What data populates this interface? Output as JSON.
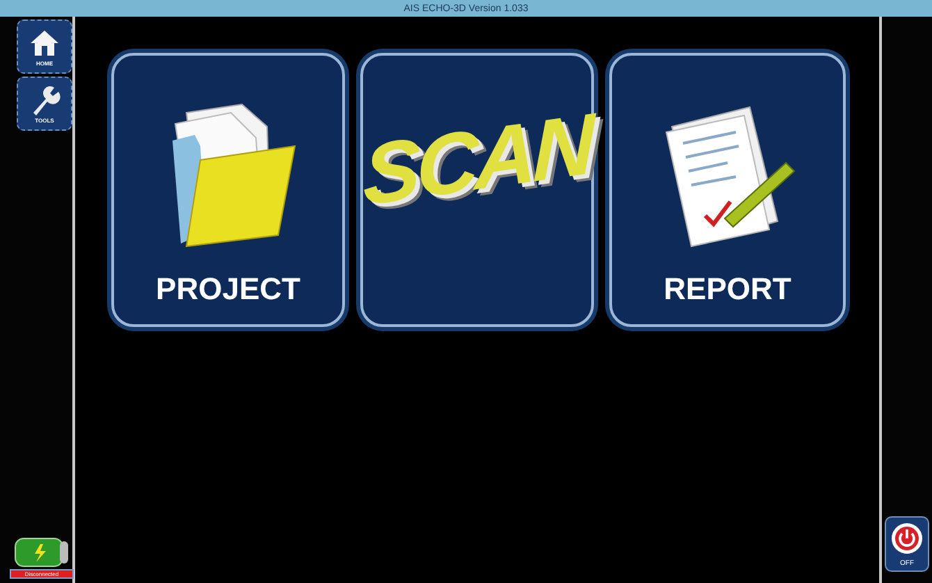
{
  "window": {
    "title": "AIS ECHO-3D Version 1.033"
  },
  "sidebar": {
    "items": [
      {
        "kind": "home",
        "label": "HOME"
      },
      {
        "kind": "tools",
        "label": "TOOLS"
      }
    ]
  },
  "tiles": [
    {
      "kind": "project",
      "label": "PROJECT"
    },
    {
      "kind": "scan",
      "label": "SCAN"
    },
    {
      "kind": "report",
      "label": "REPORT"
    }
  ],
  "connection": {
    "label": "Disconnected"
  },
  "power_button": {
    "label": "OFF"
  }
}
